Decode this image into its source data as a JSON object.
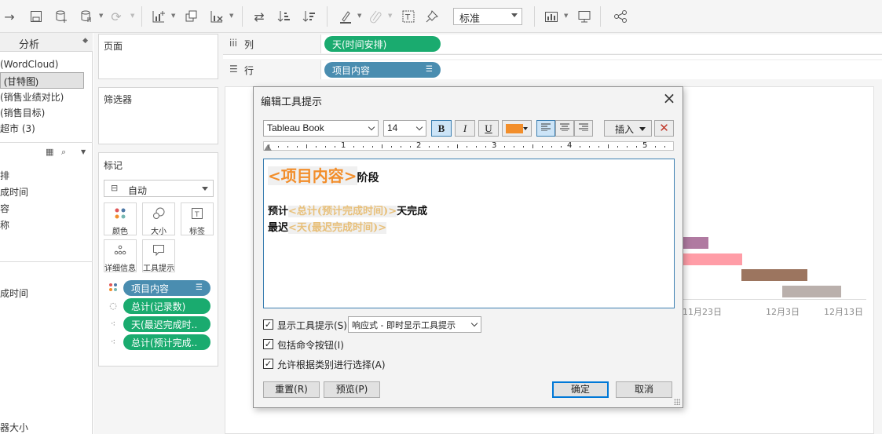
{
  "toolbar": {
    "fit_mode": "标准",
    "icons": [
      "redo-icon",
      "save-icon",
      "new-datasource-icon",
      "pause-updates-icon",
      "refresh-icon",
      "new-worksheet-icon",
      "duplicate-icon",
      "clear-sheet-icon",
      "swap-icon",
      "sort-ascending-icon",
      "sort-descending-icon",
      "highlight-icon",
      "group-icon",
      "show-labels-icon",
      "pin-icon",
      "show-me-icon",
      "presentation-icon",
      "share-icon"
    ]
  },
  "left_panel": {
    "tab": "分析",
    "sheets": [
      "(WordCloud)",
      "(甘特图)",
      "(销售业绩对比)",
      "(销售目标)",
      "超市 (3)"
    ],
    "fields_top": [
      "排",
      "成时间",
      "容",
      "称"
    ],
    "fields_bottom": [
      "成时间"
    ],
    "footer": "器大小"
  },
  "shelves": {
    "pages": "页面",
    "filters": "筛选器",
    "marks": "标记",
    "mark_type": "自动",
    "mark_buttons": [
      "颜色",
      "大小",
      "标签",
      "详细信息",
      "工具提示"
    ],
    "pills": [
      "项目内容",
      "总计(记录数)",
      "天(最迟完成时..",
      "总计(预计完成.."
    ],
    "columns_label": "列",
    "rows_label": "行",
    "columns_pill": "天(时间安排)",
    "rows_pill": "项目内容"
  },
  "viz": {
    "ticks": [
      "11月23日",
      "12月3日",
      "12月13日"
    ],
    "colors": [
      "#b07aa1",
      "#ff9da7",
      "#9c755f",
      "#bab0ac"
    ]
  },
  "dialog": {
    "title": "编辑工具提示",
    "font": "Tableau Book",
    "size": "14",
    "bold": "B",
    "italic": "I",
    "underline": "U",
    "text_color": "#f28e2b",
    "insert": "插入",
    "ruler_numbers": [
      "1",
      "2",
      "3",
      "4",
      "5"
    ],
    "editor": {
      "field1": "<项目内容>",
      "text1": "阶段",
      "text2a": "预计",
      "field2": "<总计(预计完成时间)>",
      "text2b": "天完成",
      "text3": "最迟",
      "field3": "<天(最迟完成时间)>"
    },
    "show_tooltip": "显示工具提示(S)",
    "tooltip_mode": "响应式 - 即时显示工具提示",
    "include_buttons": "包括命令按钮(I)",
    "allow_select": "允许根据类别进行选择(A)",
    "reset": "重置(R)",
    "preview": "预览(P)",
    "ok": "确定",
    "cancel": "取消"
  }
}
